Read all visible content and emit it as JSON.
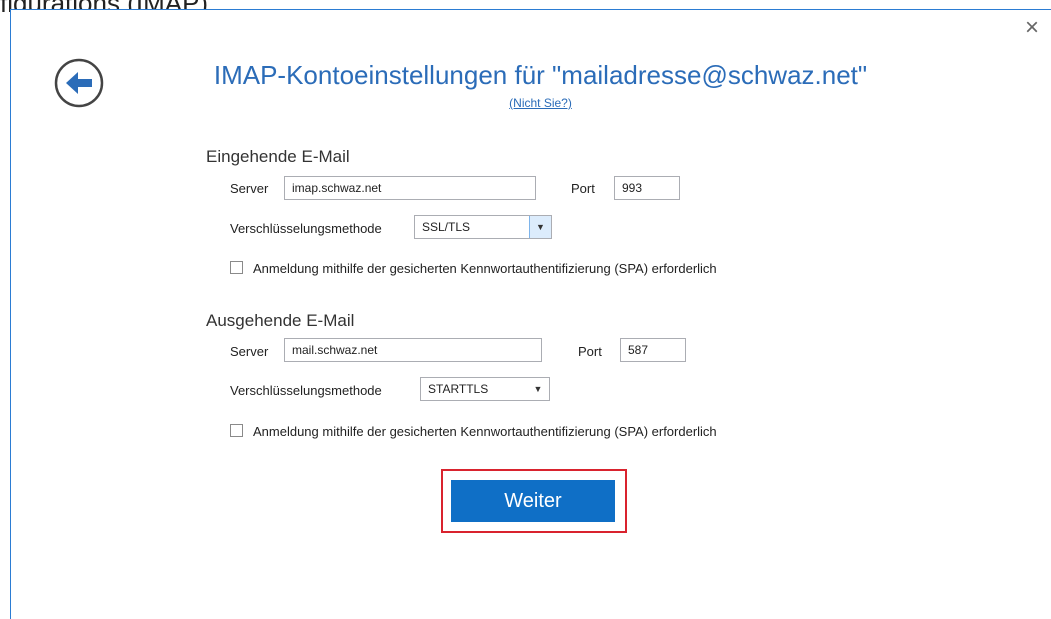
{
  "caption": "figurations (IMAP)",
  "dialog": {
    "close_symbol": "×",
    "title": "IMAP-Kontoeinstellungen für \"mailadresse@schwaz.net\"",
    "not_you_link": "(Nicht Sie?)",
    "back_icon": "back-arrow-icon"
  },
  "incoming": {
    "section_title": "Eingehende E-Mail",
    "server_label": "Server",
    "server_value": "imap.schwaz.net",
    "port_label": "Port",
    "port_value": "993",
    "encryption_label": "Verschlüsselungsmethode",
    "encryption_value": "SSL/TLS",
    "spa_label": "Anmeldung mithilfe der gesicherten Kennwortauthentifizierung (SPA) erforderlich",
    "spa_checked": false
  },
  "outgoing": {
    "section_title": "Ausgehende E-Mail",
    "server_label": "Server",
    "server_value": "mail.schwaz.net",
    "port_label": "Port",
    "port_value": "587",
    "encryption_label": "Verschlüsselungsmethode",
    "encryption_value": "STARTTLS",
    "spa_label": "Anmeldung mithilfe der gesicherten Kennwortauthentifizierung (SPA) erforderlich",
    "spa_checked": false
  },
  "buttons": {
    "next_label": "Weiter"
  },
  "colors": {
    "accent": "#2b6cb8",
    "primary_button": "#0f6fc6",
    "highlight_border": "#d9232e"
  }
}
